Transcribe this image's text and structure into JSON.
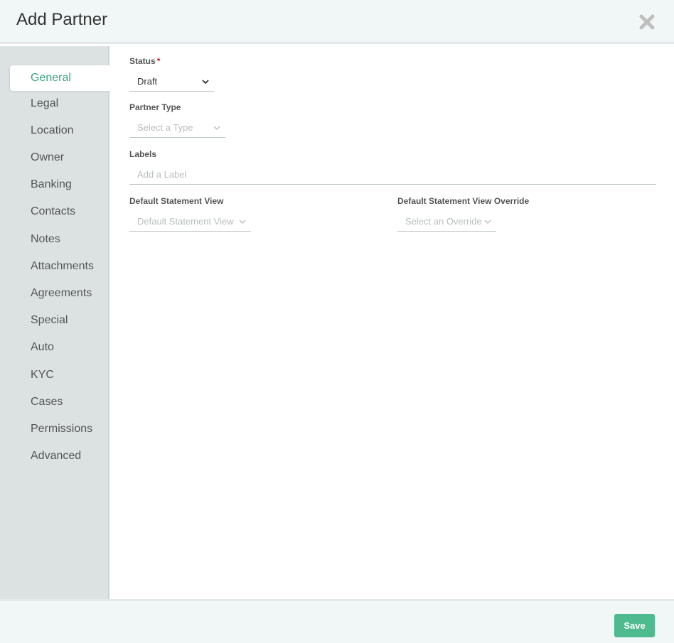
{
  "header": {
    "title": "Add Partner",
    "close_icon": "close-icon"
  },
  "sidebar": {
    "items": [
      {
        "label": "General",
        "active": true
      },
      {
        "label": "Legal"
      },
      {
        "label": "Location"
      },
      {
        "label": "Owner"
      },
      {
        "label": "Banking"
      },
      {
        "label": "Contacts"
      },
      {
        "label": "Notes"
      },
      {
        "label": "Attachments"
      },
      {
        "label": "Agreements"
      },
      {
        "label": "Special"
      },
      {
        "label": "Auto"
      },
      {
        "label": "KYC"
      },
      {
        "label": "Cases"
      },
      {
        "label": "Permissions"
      },
      {
        "label": "Advanced"
      }
    ]
  },
  "form": {
    "status": {
      "label": "Status",
      "required_mark": "*",
      "value": "Draft"
    },
    "partner_type": {
      "label": "Partner Type",
      "placeholder": "Select a Type"
    },
    "labels": {
      "label": "Labels",
      "placeholder": "Add a Label"
    },
    "default_statement_view": {
      "label": "Default Statement View",
      "placeholder": "Default Statement View"
    },
    "default_statement_view_override": {
      "label": "Default Statement View Override",
      "placeholder": "Select an Override"
    }
  },
  "footer": {
    "save_label": "Save"
  },
  "colors": {
    "accent": "#4dbb8f",
    "active_text": "#3aa57f",
    "required": "#d0202c",
    "sidebar_bg": "#dce2e2"
  }
}
